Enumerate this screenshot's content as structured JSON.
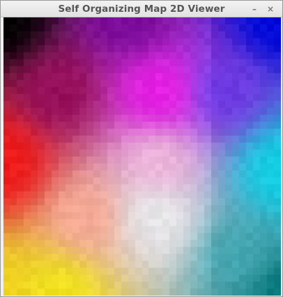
{
  "window": {
    "title": "Self Organizing Map 2D Viewer",
    "minimize_glyph": "–",
    "close_glyph": "×"
  },
  "som_map": {
    "grid_columns": 40,
    "grid_rows": 40,
    "corner_colors": {
      "top_left": "#000000",
      "top_right": "#0a14e6",
      "bottom_left": "#f0d41e",
      "bottom_right": "#16868a"
    },
    "edge_colors": {
      "top": "#7a0a9a",
      "left": "#f01818",
      "right": "#1edcf0",
      "bottom": "#f2e41e"
    },
    "center_color": "#e8e8ea",
    "highlight_colors": [
      {
        "name": "magenta",
        "color": "#e81ee6"
      },
      {
        "name": "light-pink",
        "color": "#f0b8dc"
      }
    ]
  }
}
